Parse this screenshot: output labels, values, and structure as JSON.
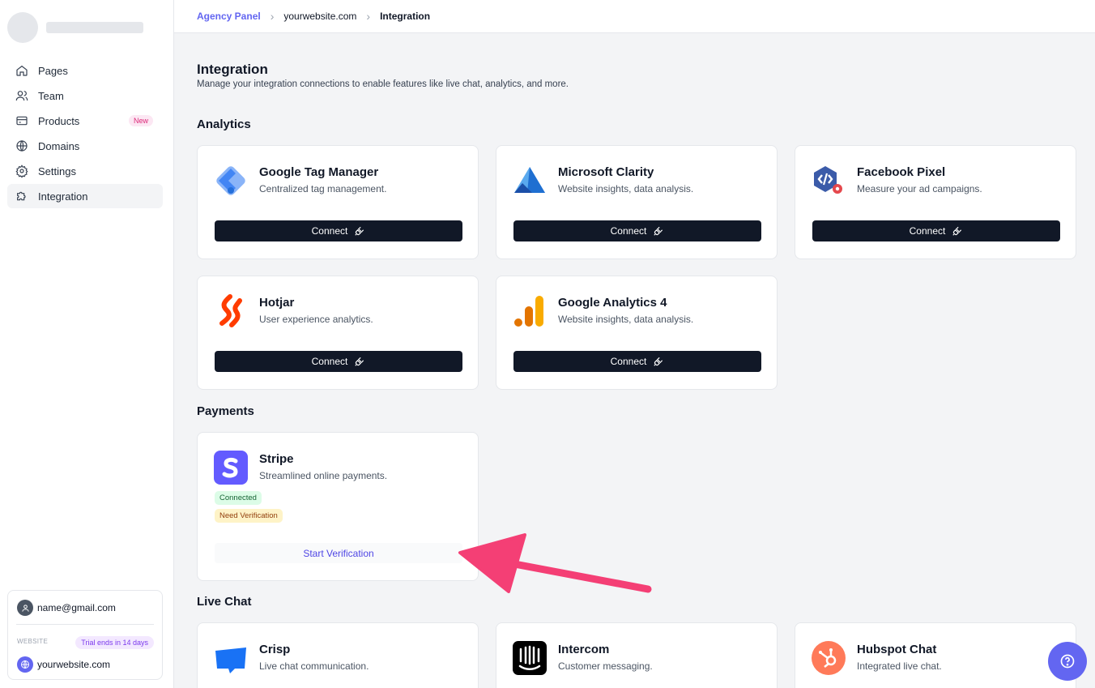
{
  "breadcrumb": {
    "root": "Agency Panel",
    "site": "yourwebsite.com",
    "current": "Integration"
  },
  "sidebar": {
    "items": [
      {
        "label": "Pages",
        "icon": "home-icon"
      },
      {
        "label": "Team",
        "icon": "users-icon"
      },
      {
        "label": "Products",
        "icon": "card-icon",
        "badge": "New"
      },
      {
        "label": "Domains",
        "icon": "globe-icon"
      },
      {
        "label": "Settings",
        "icon": "gear-icon"
      },
      {
        "label": "Integration",
        "icon": "puzzle-icon",
        "active": true
      }
    ],
    "account": {
      "email": "name@gmail.com",
      "website_label": "WEBSITE",
      "trial": "Trial ends in 14 days",
      "site": "yourwebsite.com"
    }
  },
  "page": {
    "title": "Integration",
    "subtitle": "Manage your integration connections to enable features like live chat, analytics, and more."
  },
  "sections": {
    "analytics": {
      "title": "Analytics",
      "cards": [
        {
          "name": "Google Tag Manager",
          "desc": "Centralized tag management.",
          "button": "Connect"
        },
        {
          "name": "Microsoft Clarity",
          "desc": "Website insights, data analysis.",
          "button": "Connect"
        },
        {
          "name": "Facebook Pixel",
          "desc": "Measure your ad campaigns.",
          "button": "Connect"
        },
        {
          "name": "Hotjar",
          "desc": "User experience analytics.",
          "button": "Connect"
        },
        {
          "name": "Google Analytics 4",
          "desc": "Website insights, data analysis.",
          "button": "Connect"
        }
      ]
    },
    "payments": {
      "title": "Payments",
      "cards": [
        {
          "name": "Stripe",
          "desc": "Streamlined online payments.",
          "status_connected": "Connected",
          "status_verify": "Need Verification",
          "button": "Start Verification"
        }
      ]
    },
    "livechat": {
      "title": "Live Chat",
      "cards": [
        {
          "name": "Crisp",
          "desc": "Live chat communication."
        },
        {
          "name": "Intercom",
          "desc": "Customer messaging."
        },
        {
          "name": "Hubspot Chat",
          "desc": "Integrated live chat."
        }
      ]
    }
  },
  "colors": {
    "accent": "#6366f1",
    "button_dark": "#111827",
    "arrow": "#f43f75"
  }
}
